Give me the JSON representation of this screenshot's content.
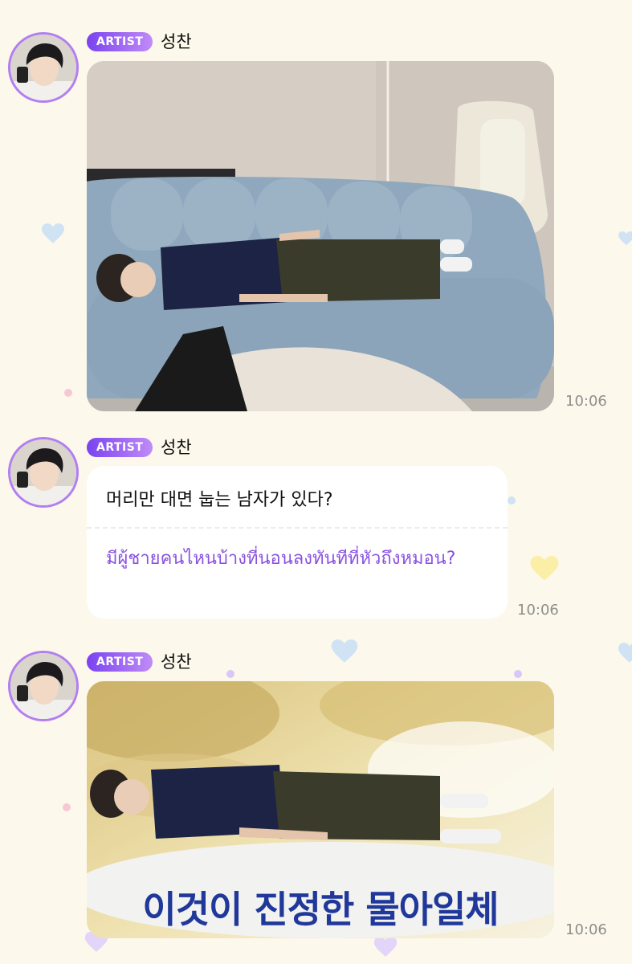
{
  "messages": [
    {
      "badge": "ARTIST",
      "sender": "성찬",
      "type": "photo",
      "time": "10:06"
    },
    {
      "badge": "ARTIST",
      "sender": "성찬",
      "type": "text",
      "text": "머리만 대면 눕는 남자가 있다?",
      "translation": "มีผู้ชายคนไหนบ้างที่นอนลงทันทีที่หัวถึงหมอน?",
      "time": "10:06"
    },
    {
      "badge": "ARTIST",
      "sender": "성찬",
      "type": "photo",
      "caption": "이것이 진정한 물아일체",
      "time": "10:06"
    }
  ],
  "colors": {
    "background": "#fdf8ec",
    "badge_start": "#7a43f0",
    "badge_end": "#c08bf7",
    "translation_text": "#8a52e0",
    "timestamp": "#8e8e8e"
  },
  "icons": [
    "avatar-image",
    "heart-decoration",
    "dot-decoration"
  ]
}
